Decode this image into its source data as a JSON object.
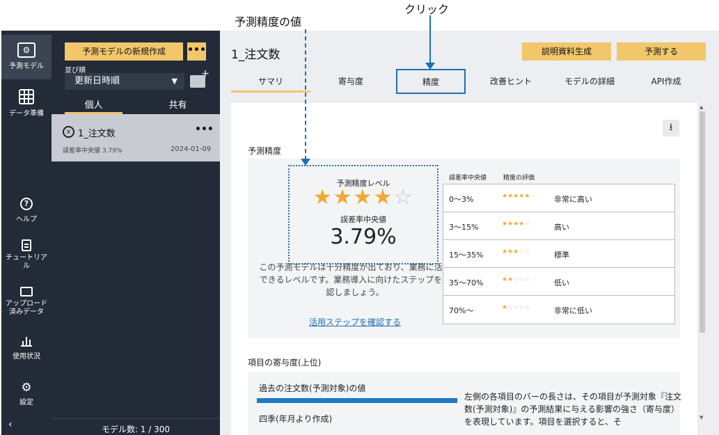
{
  "annotations": {
    "accuracy_callout": "予測精度の値",
    "click_callout": "クリック"
  },
  "nav": {
    "items": [
      {
        "label": "予測モデル",
        "icon": "model-icon"
      },
      {
        "label": "データ準備",
        "icon": "table-icon"
      },
      {
        "label": "ヘルプ",
        "icon": "help-icon"
      },
      {
        "label": "チュートリアル",
        "icon": "document-icon"
      },
      {
        "label": "アップロード済みデータ",
        "icon": "folder-icon"
      },
      {
        "label": "使用状況",
        "icon": "bar-chart-icon"
      },
      {
        "label": "設定",
        "icon": "gear-icon"
      }
    ],
    "collapse": "‹"
  },
  "panel": {
    "new_model": "予測モデルの新規作成",
    "more": "•••",
    "sort_label": "並び順",
    "sort_value": "更新日時順",
    "tab_personal": "個人",
    "tab_shared": "共有",
    "model": {
      "name": "1_注文数",
      "metric": "誤差率中央値 3.79%",
      "date": "2024-01-09",
      "more": "•••",
      "icon_glyph": "x"
    },
    "count": "モデル数: 1 / 300"
  },
  "main": {
    "title": "1_注文数",
    "btn_doc": "説明資料生成",
    "btn_predict": "予測する",
    "tabs": [
      "サマリ",
      "寄与度",
      "精度",
      "改善ヒント",
      "モデルの詳細",
      "API作成"
    ],
    "accuracy": {
      "section_title": "予測精度",
      "level_label": "予測精度レベル",
      "stars_filled": 4,
      "stars_total": 5,
      "median_label": "誤差率中央値",
      "median_value": "3.79%",
      "desc": "この予測モデルは十分精度が出ており、業務に活用できるレベルです。業務導入に向けたステップを確認しましょう。",
      "link": "活用ステップを確認する",
      "table_head_range": "誤差率中央値",
      "table_head_eval": "精度の評価",
      "rows": [
        {
          "range": "0～3%",
          "stars": 5,
          "rating": "非常に高い"
        },
        {
          "range": "3～15%",
          "stars": 4,
          "rating": "高い"
        },
        {
          "range": "15～35%",
          "stars": 3,
          "rating": "標準"
        },
        {
          "range": "35～70%",
          "stars": 2,
          "rating": "低い"
        },
        {
          "range": "70%～",
          "stars": 1,
          "rating": "非常に低い"
        }
      ]
    },
    "contribution": {
      "section_title": "項目の寄与度(上位)",
      "item1": "過去の注文数(予測対象)の値",
      "item1_bar_fraction": 1.0,
      "item2": "四季(年月より作成)",
      "desc": "左側の各項目のバーの長さは、その項目が予測対象『注文数(予測対象)』の予測結果に与える影響の強さ（寄与度）を表現しています。項目を選択すると、そ"
    }
  },
  "colors": {
    "accent": "#f2c66b",
    "sidebar": "#232b38",
    "link": "#1e6fb0",
    "bar": "#1e78c8",
    "star": "#f0a830"
  }
}
